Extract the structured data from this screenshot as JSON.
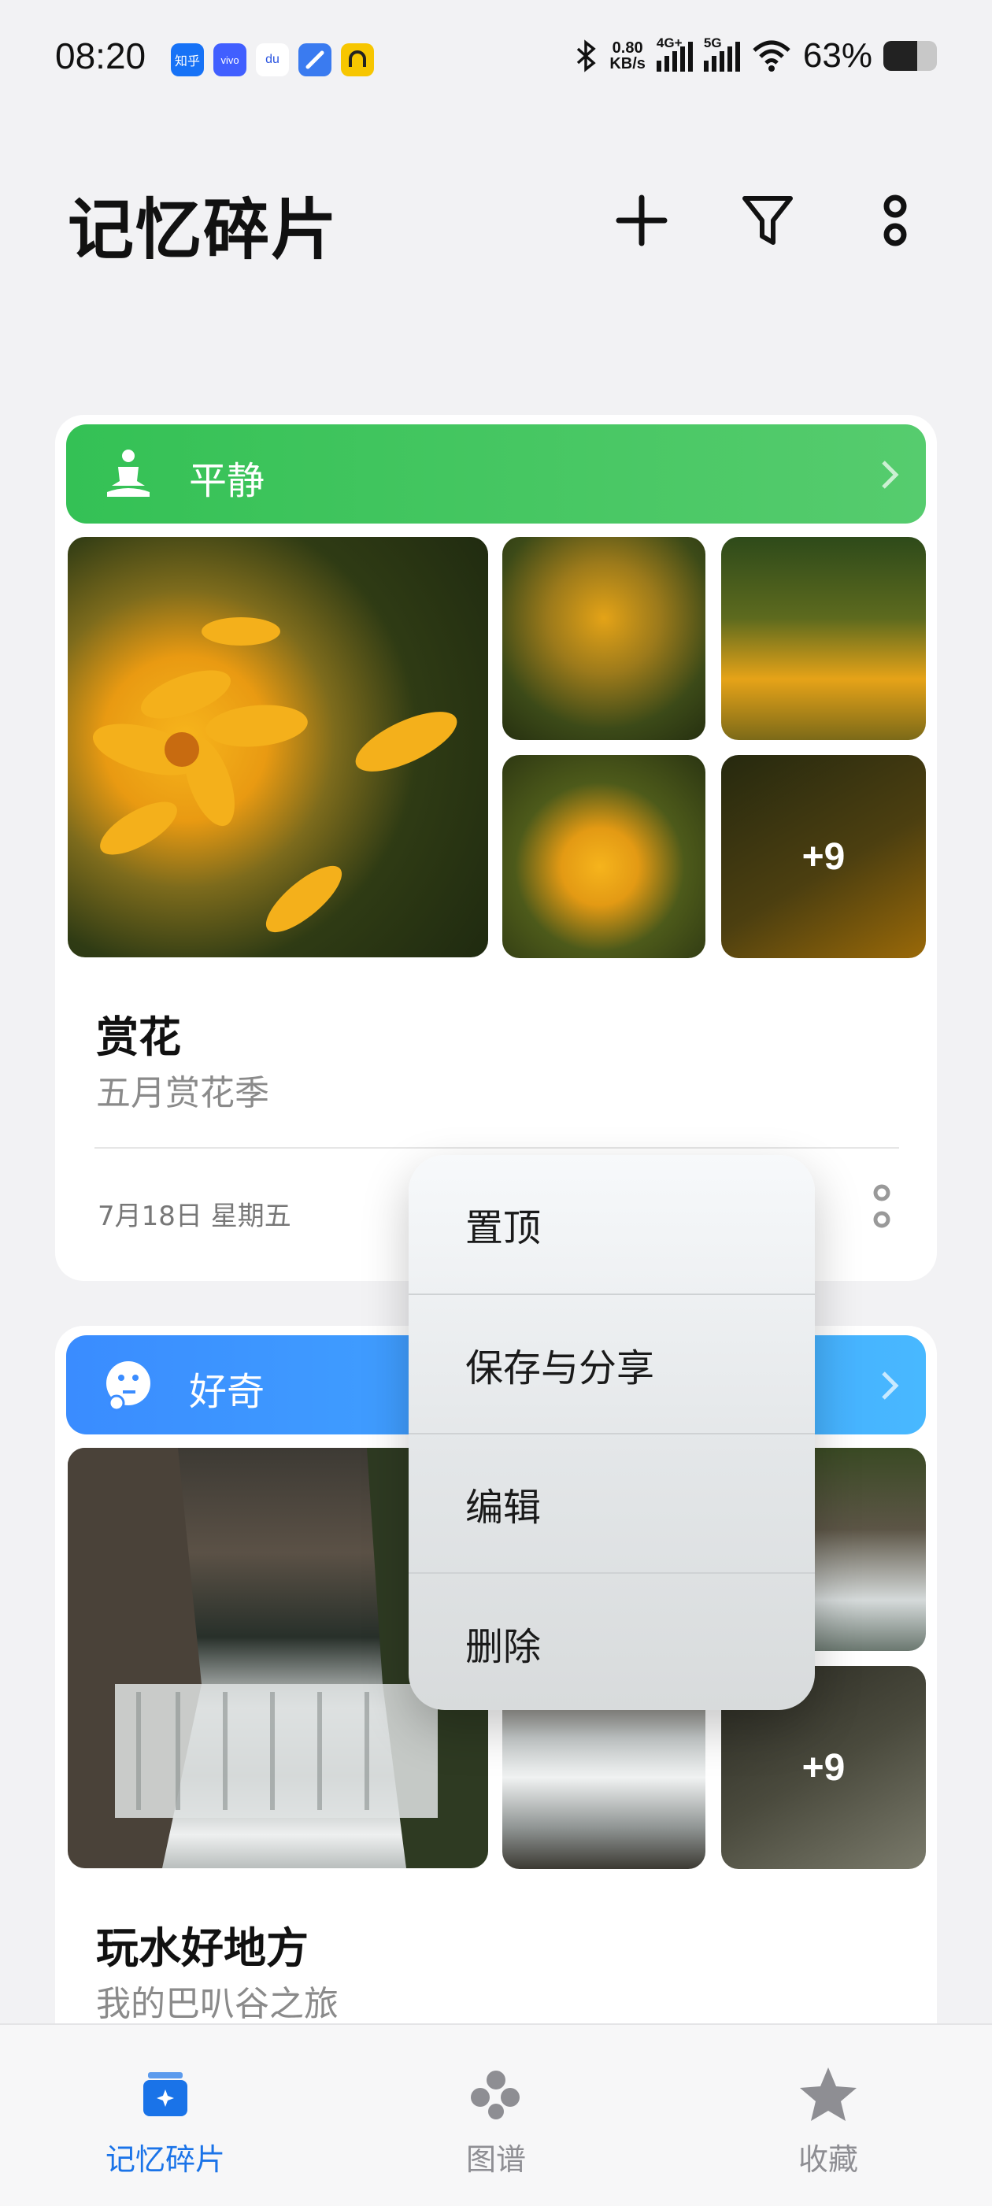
{
  "status_bar": {
    "time": "08:20",
    "apps": [
      {
        "name": "zhihu",
        "text": "知乎",
        "color": "#1772f6"
      },
      {
        "name": "vivo",
        "text": "vivo",
        "color": "#415fff"
      },
      {
        "name": "baidu",
        "text": "du",
        "color": "#ffffff"
      },
      {
        "name": "app-blue",
        "text": "",
        "color": "#3a7bf0"
      },
      {
        "name": "app-yellow",
        "text": "",
        "color": "#f7c600"
      }
    ],
    "net_speed": "0.80",
    "net_unit": "KB/s",
    "signal1": "4G+",
    "signal2": "5G",
    "battery": "63%",
    "battery_level": 0.63
  },
  "header": {
    "title": "记忆碎片",
    "add_icon": "plus-icon",
    "filter_icon": "filter-icon",
    "more_icon": "more-vertical-icon"
  },
  "cards": [
    {
      "mood": "平静",
      "mood_icon": "meditation-icon",
      "banner_colors": [
        "#34c155",
        "#56cc6e"
      ],
      "title": "赏花",
      "subtitle": "五月赏花季",
      "date": "7月18日 星期五",
      "extra_count": "+9"
    },
    {
      "mood": "好奇",
      "mood_icon": "thinking-face-icon",
      "banner_colors": [
        "#3a8cff",
        "#48b8ff"
      ],
      "title": "玩水好地方",
      "subtitle": "我的巴叭谷之旅",
      "extra_count": "+9"
    }
  ],
  "menu": {
    "items": [
      "置顶",
      "保存与分享",
      "编辑",
      "删除"
    ]
  },
  "tabbar": {
    "tabs": [
      {
        "label": "记忆碎片",
        "icon": "memory-box-icon",
        "active": true
      },
      {
        "label": "图谱",
        "icon": "graph-icon",
        "active": false
      },
      {
        "label": "收藏",
        "icon": "star-icon",
        "active": false
      }
    ],
    "active_color": "#1a73e8",
    "inactive_color": "#8e8e93"
  }
}
